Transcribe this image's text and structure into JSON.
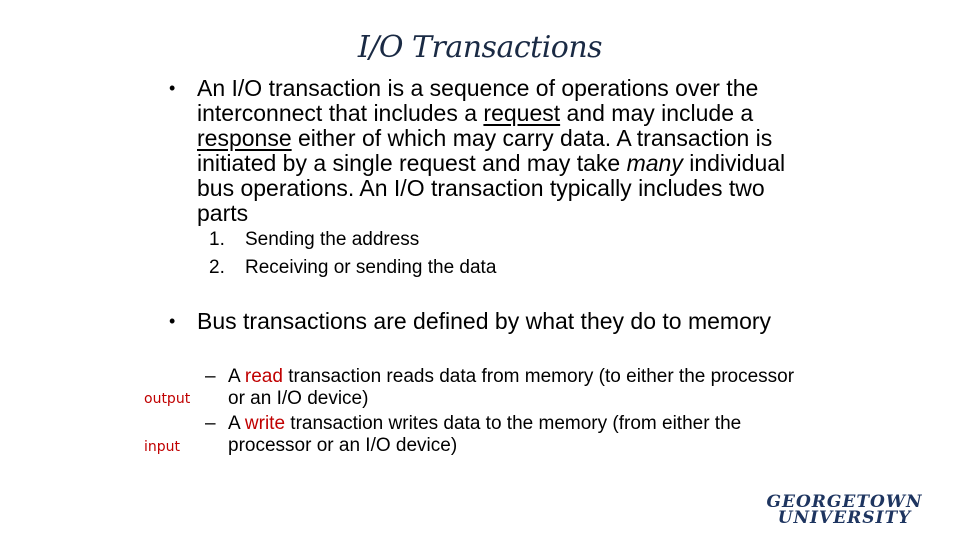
{
  "title": "I/O Transactions",
  "bullet1": {
    "part1": "An I/O transaction is a sequence of operations over the interconnect that includes a ",
    "request": "request",
    "part2": " and may include a ",
    "response": "response",
    "part3": " either of which may carry data. A transaction is initiated by a single request and may take ",
    "many": "many",
    "part4": " individual bus operations.  An I/O transaction typically includes two parts"
  },
  "sublist": [
    {
      "num": "1.",
      "text": "Sending the address"
    },
    {
      "num": "2.",
      "text": "Receiving or sending the data"
    }
  ],
  "bullet2": "Bus transactions are defined by what they do to memory",
  "dash_items": [
    {
      "prefix": "A ",
      "keyword": "read",
      "rest": " transaction reads data from memory (to either the processor or an I/O device)"
    },
    {
      "prefix": "A ",
      "keyword": "write",
      "rest": " transaction writes data to the memory (from either the processor or an I/O device)"
    }
  ],
  "side_labels": {
    "output": "output",
    "input": "input"
  },
  "logo": {
    "line1": "GEORGETOWN",
    "line2": "UNIVERSITY"
  },
  "colors": {
    "title": "#1a2a44",
    "accent_red": "#c00000",
    "logo": "#1e3560"
  }
}
